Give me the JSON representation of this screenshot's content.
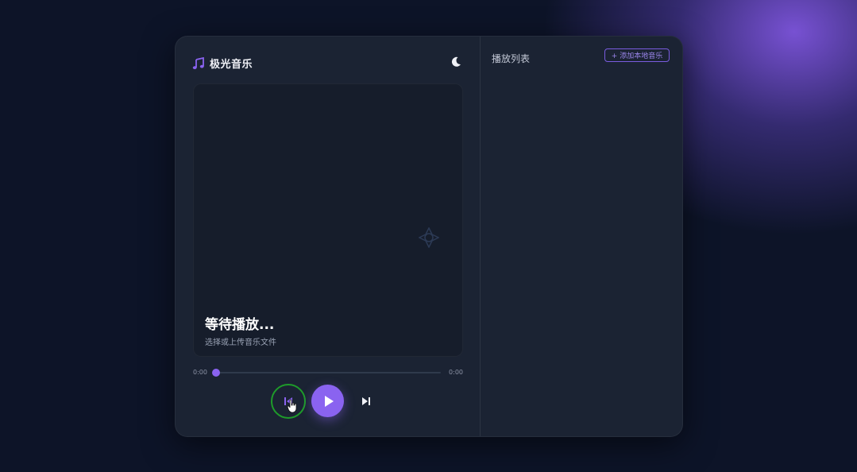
{
  "app": {
    "name": "极光音乐",
    "brand_icon": "music-note-icon",
    "theme_icon": "moon-icon"
  },
  "player": {
    "title": "等待播放...",
    "subtitle": "选择或上传音乐文件",
    "current_time": "0:00",
    "total_time": "0:00",
    "progress": 0
  },
  "controls": {
    "prev_icon": "skip-previous-icon",
    "play_icon": "play-icon",
    "next_icon": "skip-next-icon"
  },
  "playlist": {
    "title": "播放列表",
    "add_label": "+ 添加本地音乐"
  },
  "colors": {
    "accent": "#8a63f0",
    "card": "#1b2333",
    "background": "#0d1428",
    "focus_ring": "#1e9b2a"
  }
}
